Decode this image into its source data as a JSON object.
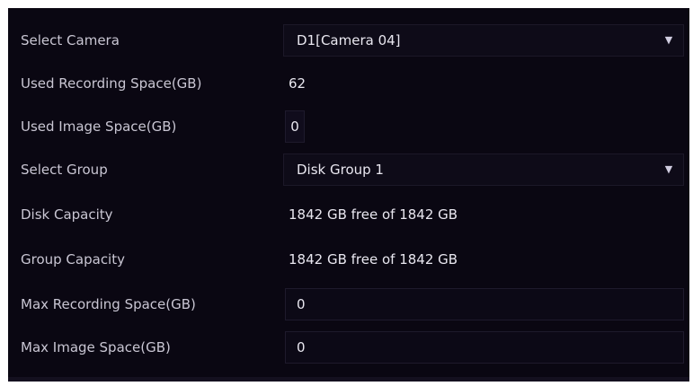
{
  "rows": [
    {
      "label": "Select Camera",
      "value": "D1[Camera 04]",
      "kind": "select"
    },
    {
      "label": "Used Recording Space(GB)",
      "value": "62",
      "kind": "text"
    },
    {
      "label": "Used Image Space(GB)",
      "value": "0",
      "kind": "spin"
    },
    {
      "label": "Select Group",
      "value": "Disk Group 1",
      "kind": "select"
    },
    {
      "label": "Disk Capacity",
      "value": "1842 GB free of 1842 GB",
      "kind": "text"
    },
    {
      "label": "Group Capacity",
      "value": "1842 GB free of 1842 GB",
      "kind": "text"
    },
    {
      "label": "Max Recording Space(GB)",
      "value": "0",
      "kind": "input"
    },
    {
      "label": "Max Image Space(GB)",
      "value": "0",
      "kind": "input"
    }
  ],
  "icons": {
    "dropdown": "chevron-down-icon"
  },
  "colors": {
    "background": "#0a0712",
    "text": "#e9e7f0",
    "label": "#c9c6d3"
  }
}
